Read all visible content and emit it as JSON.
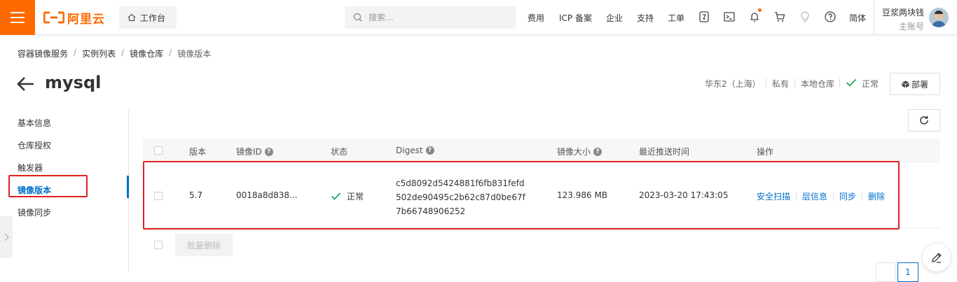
{
  "topbar": {
    "brand": "阿里云",
    "workbench_label": "工作台",
    "search_placeholder": "搜索...",
    "links": [
      "费用",
      "ICP 备案",
      "企业",
      "支持",
      "工单"
    ],
    "lang": "简体",
    "account_name": "豆浆两块钱",
    "account_role": "主账号",
    "accent_color": "#ff6a00"
  },
  "breadcrumb": [
    "容器镜像服务",
    "实例列表",
    "镜像仓库",
    "镜像版本"
  ],
  "header": {
    "title": "mysql",
    "region": "华东2（上海）",
    "visibility": "私有",
    "repo_type": "本地仓库",
    "status": "正常",
    "deploy_label": "部署"
  },
  "sidenav": {
    "items": [
      "基本信息",
      "仓库授权",
      "触发器",
      "镜像版本",
      "镜像同步"
    ],
    "active_index": 3
  },
  "table": {
    "columns": [
      "版本",
      "镜像ID",
      "状态",
      "Digest",
      "镜像大小",
      "最近推送时间",
      "操作"
    ],
    "rows": [
      {
        "version": "5.7",
        "image_id": "0018a8d838...",
        "status": "正常",
        "digest_lines": [
          "c5d8092d5424881f6fb831fefd",
          "502de90495c2b62c87d0be67f",
          "7b66748906252"
        ],
        "size": "123.986 MB",
        "pushed_at": "2023-03-20 17:43:05",
        "actions": [
          "安全扫描",
          "层信息",
          "同步",
          "删除"
        ]
      }
    ]
  },
  "footer": {
    "batch_delete_label": "批量删除",
    "current_page": "1"
  },
  "colors": {
    "link": "#0070cc",
    "success": "#23a55a",
    "highlight": "#e02020"
  }
}
